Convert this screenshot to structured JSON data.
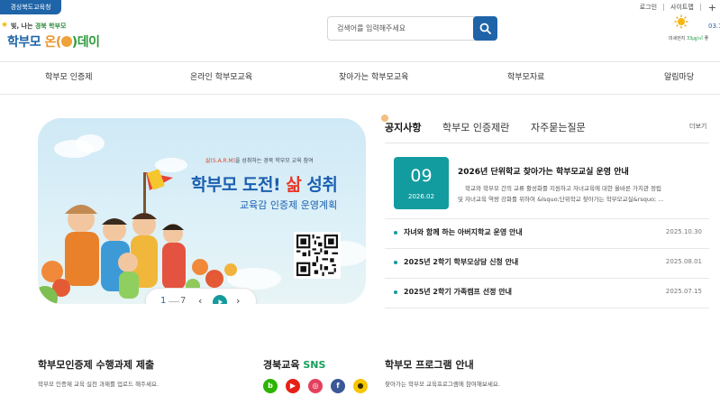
{
  "topbar": {
    "org_label": "경상북도교육청",
    "links": [
      "로그인",
      "사이트맵"
    ],
    "plus": "+"
  },
  "logo": {
    "tagline_prefix": "빛, 나는",
    "tagline_highlight": "경북 학부모",
    "main_a": "학부모",
    "main_b": "온(",
    "main_c": ")데이"
  },
  "search": {
    "placeholder": "검색어를 입력해주세요",
    "button_icon": "search-icon"
  },
  "weather": {
    "icon": "sun-icon",
    "temp": "03.1",
    "dust_label": "미세먼지",
    "dust_value": "33㎍/㎥",
    "dust_suffix": "좋"
  },
  "nav": {
    "items": [
      "학부모 인증제",
      "온라인 학부모교육",
      "찾아가는 학부모교육",
      "학부모자료",
      "알림마당"
    ]
  },
  "banner": {
    "subtitle_highlight": "삶(S.A.R.M)",
    "subtitle_rest": "을 성취하는 경북 학부모 교육 참여",
    "title_a": "학부모 도전!",
    "title_b": "삶",
    "title_c": "성취",
    "line2": "교육감 인증제 운영계획",
    "pager": {
      "current": "1",
      "total": "7",
      "prev": "‹",
      "next": "›"
    }
  },
  "notices": {
    "tabs": [
      "공지사항",
      "학부모 인증제란",
      "자주묻는질문"
    ],
    "more": "더보기",
    "featured": {
      "day": "09",
      "year_month": "2026.02",
      "title": "2026년 단위학교 찾아가는 학부모교실 운영 안내",
      "desc_line1": "학교와 학부모 간의 교류 활성화를 지원하고 자녀교육에 대한 올바른 가치관 정립",
      "desc_line2": "및 자녀교육 역량 강화를 위하여 &lsquo;단위학교 찾아가는 학부모교실&rsquo; ..."
    },
    "list": [
      {
        "title": "자녀와 함께 하는 아버지학교 운영 안내",
        "date": "2025.10.30"
      },
      {
        "title": "2025년 2학기 학부모상담 신청 안내",
        "date": "2025.08.01"
      },
      {
        "title": "2025년 2학기 가족캠프 선정 안내",
        "date": "2025.07.15"
      }
    ]
  },
  "sections": {
    "cert": {
      "title": "학부모인증제 수행과제 제출",
      "desc": "학부모 인증제 교육 실천 과제를 업로드 해주세요."
    },
    "sns": {
      "title_a": "경북교육",
      "title_b": "SNS"
    },
    "program": {
      "title": "학부모 프로그램 안내",
      "desc": "찾아가는 학부모 교육프로그램에 참여해보세요."
    }
  },
  "sns_icons": [
    {
      "icon": "blog-icon",
      "glyph": "b",
      "color": "#2db400"
    },
    {
      "icon": "youtube-icon",
      "glyph": "▶",
      "color": "#e62117"
    },
    {
      "icon": "instagram-icon",
      "glyph": "◎",
      "color": "#e4405f"
    },
    {
      "icon": "facebook-icon",
      "glyph": "f",
      "color": "#3b5998"
    },
    {
      "icon": "kakao-icon",
      "glyph": "●",
      "color": "#f7c600"
    }
  ]
}
